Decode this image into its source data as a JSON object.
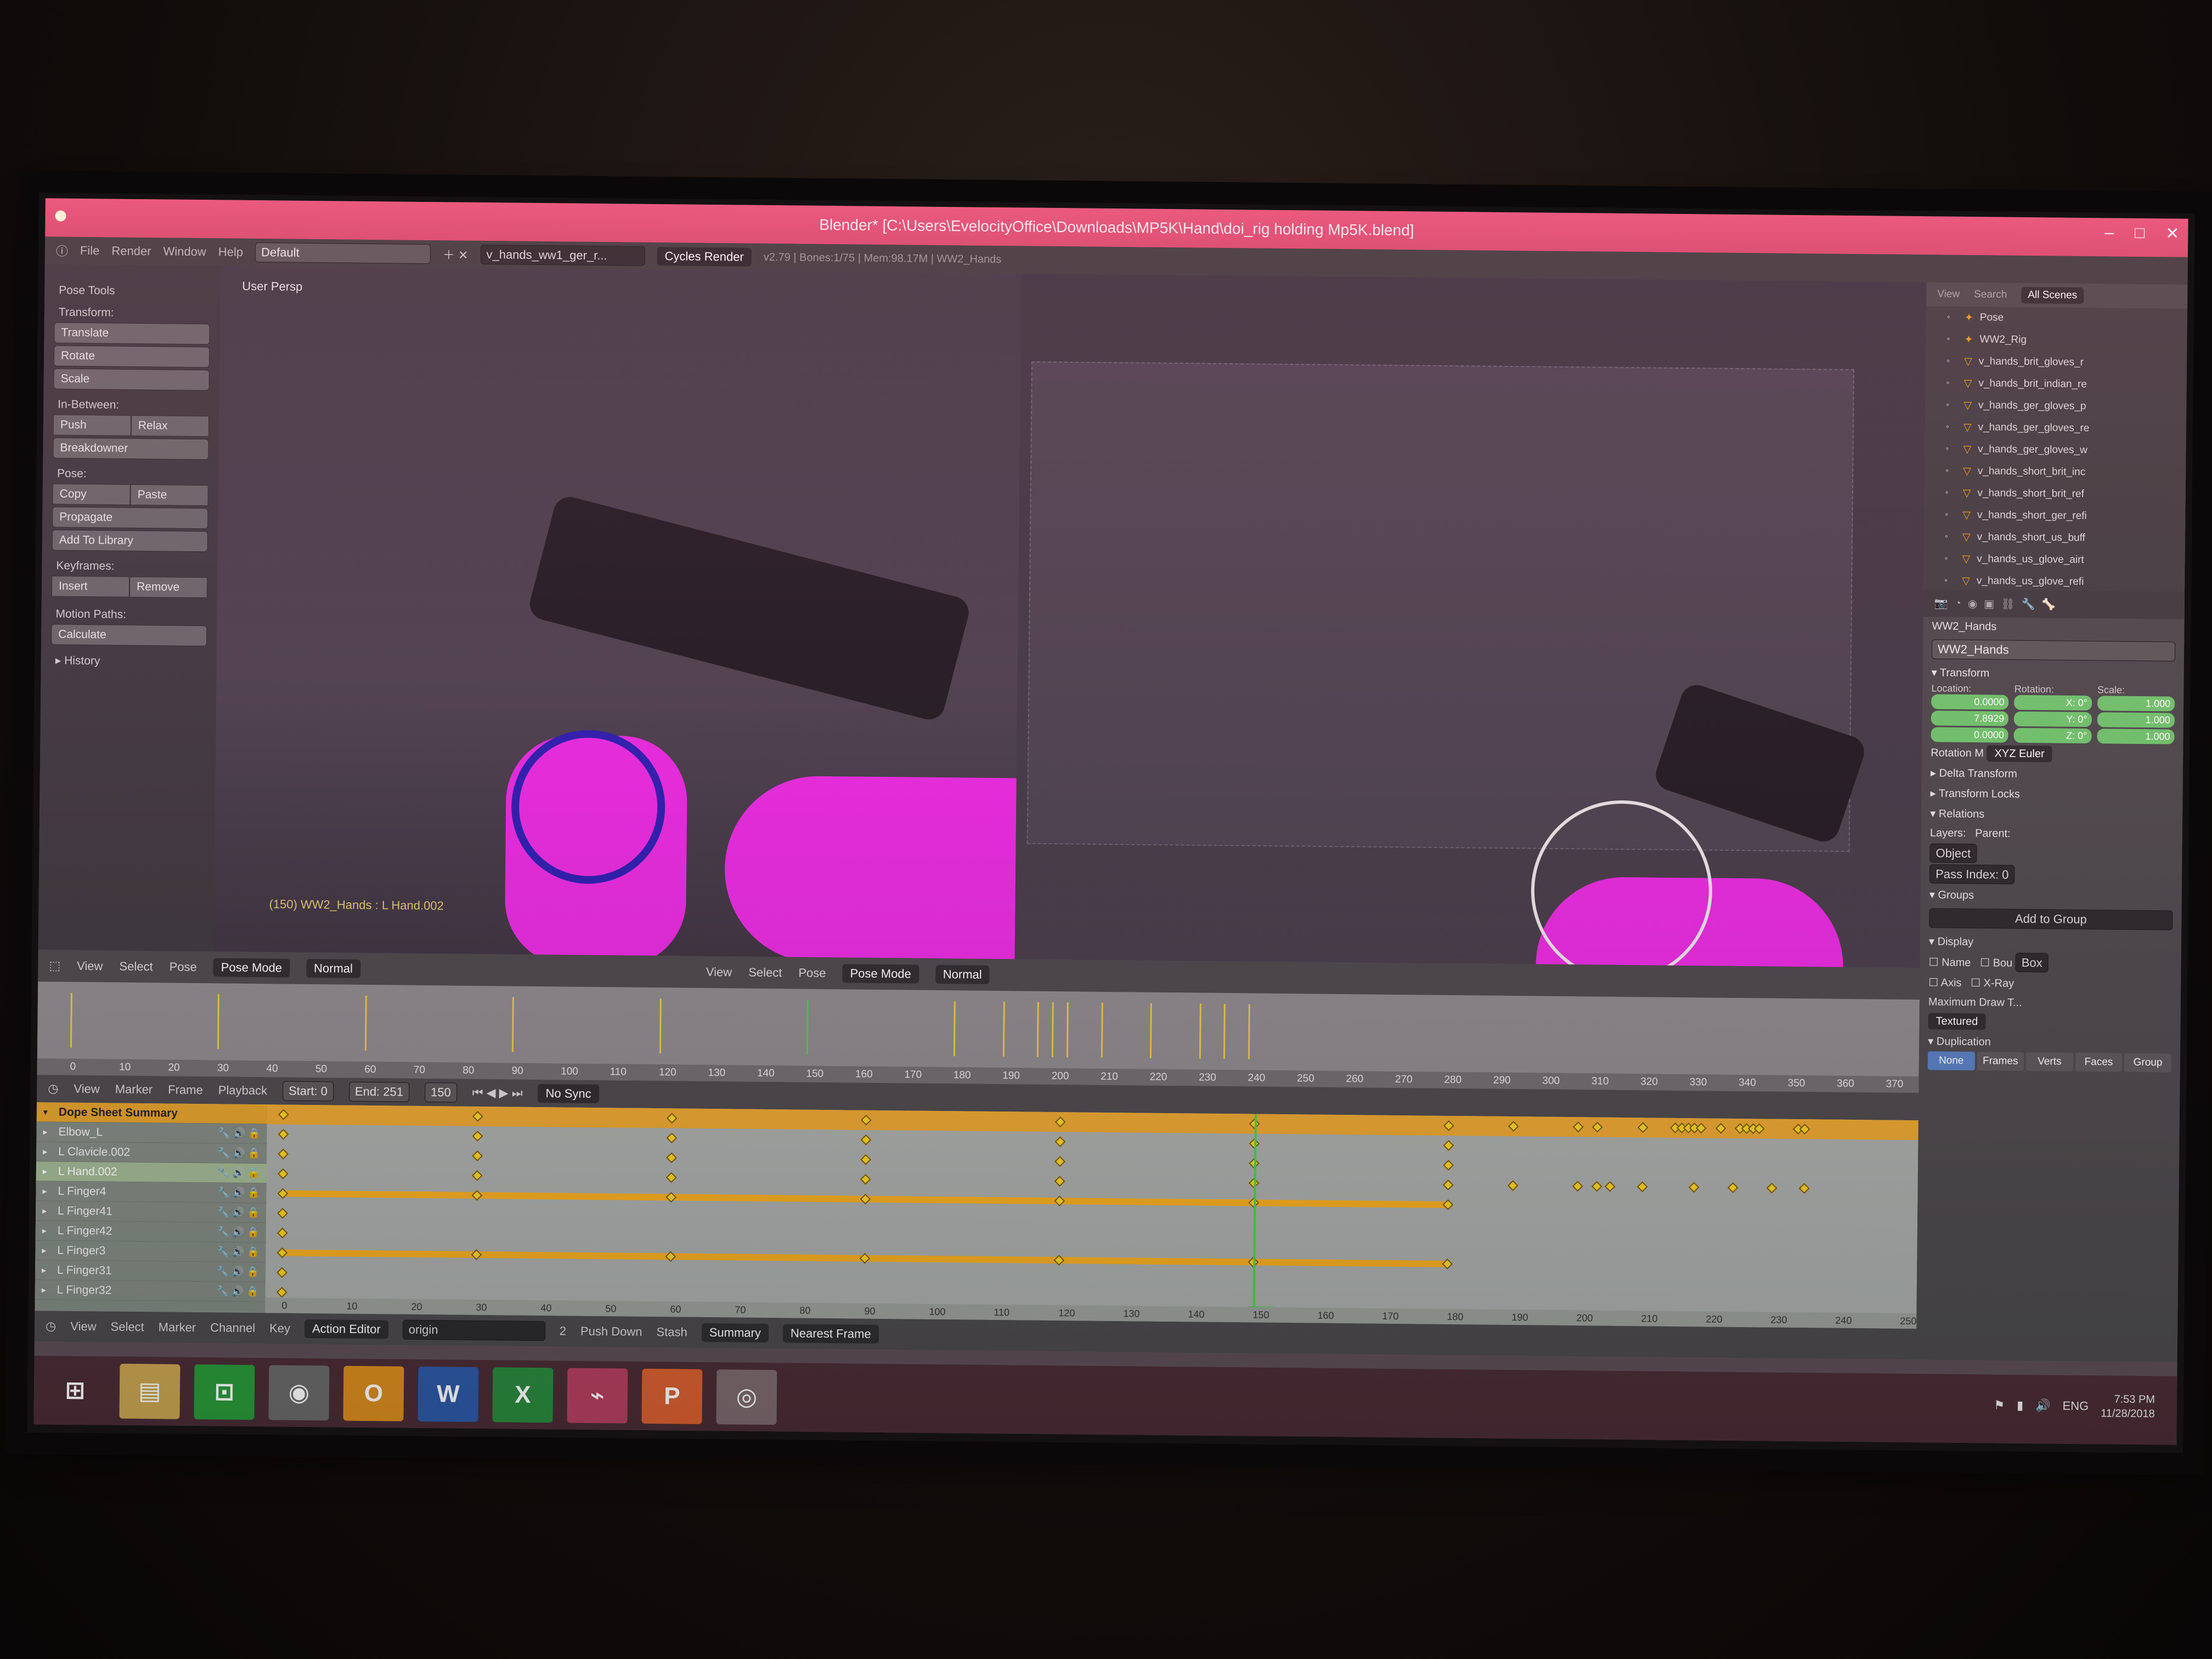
{
  "window": {
    "title": "Blender* [C:\\Users\\EvelocityOffice\\Downloads\\MP5K\\Hand\\doi_rig holding Mp5K.blend]",
    "controls": [
      "–",
      "□",
      "✕"
    ]
  },
  "menubar": {
    "items": [
      "File",
      "Render",
      "Window",
      "Help"
    ],
    "layout": "Default",
    "scene": "v_hands_ww1_ger_r...",
    "render_engine": "Cycles Render",
    "stats": "v2.79 | Bones:1/75 | Mem:98.17M | WW2_Hands"
  },
  "toolshelf": {
    "title": "Pose Tools",
    "transform_label": "Transform:",
    "translate": "Translate",
    "rotate": "Rotate",
    "scale": "Scale",
    "inbetween_label": "In-Between:",
    "push": "Push",
    "relax": "Relax",
    "breakdowner": "Breakdowner",
    "pose_label": "Pose:",
    "copy": "Copy",
    "paste": "Paste",
    "propagate": "Propagate",
    "add_to_library": "Add To Library",
    "keyframes_label": "Keyframes:",
    "insert": "Insert",
    "remove": "Remove",
    "motion_paths_label": "Motion Paths:",
    "calculate": "Calculate",
    "history": "History"
  },
  "viewport_left": {
    "label": "User Persp",
    "status": "(150) WW2_Hands : L Hand.002"
  },
  "viewport_header": {
    "view": "View",
    "select": "Select",
    "pose": "Pose",
    "mode": "Pose Mode",
    "pivot": "Normal"
  },
  "timeline": {
    "ruler": [
      "0",
      "10",
      "20",
      "30",
      "40",
      "50",
      "60",
      "70",
      "80",
      "90",
      "100",
      "110",
      "120",
      "130",
      "140",
      "150",
      "160",
      "170",
      "180",
      "190",
      "200",
      "210",
      "220",
      "230",
      "240",
      "250",
      "260",
      "270",
      "280",
      "290",
      "300",
      "310",
      "320",
      "330",
      "340",
      "350",
      "360",
      "370"
    ],
    "menus": [
      "View",
      "Marker",
      "Frame",
      "Playback"
    ],
    "start_label": "Start:",
    "start": "0",
    "end_label": "End:",
    "end": "251",
    "current": "150",
    "sync": "No Sync"
  },
  "dopesheet": {
    "channels": [
      "Dope Sheet Summary",
      "Elbow_L",
      "L Clavicle.002",
      "L Hand.002",
      "L Finger4",
      "L Finger41",
      "L Finger42",
      "L Finger3",
      "L Finger31",
      "L Finger32"
    ],
    "ruler": [
      "0",
      "10",
      "20",
      "30",
      "40",
      "50",
      "60",
      "70",
      "80",
      "90",
      "100",
      "110",
      "120",
      "130",
      "140",
      "150",
      "160",
      "170",
      "180",
      "190",
      "200",
      "210",
      "220",
      "230",
      "240",
      "250"
    ],
    "current_frame": "150"
  },
  "dope_header": {
    "menus": [
      "View",
      "Select",
      "Marker",
      "Channel",
      "Key"
    ],
    "editor": "Action Editor",
    "action": "origin",
    "users": "2",
    "push_down": "Push Down",
    "stash": "Stash",
    "summary": "Summary",
    "snap": "Nearest Frame"
  },
  "outliner": {
    "view": "View",
    "search": "Search",
    "scenes": "All Scenes",
    "items": [
      "Pose",
      "WW2_Rig",
      "v_hands_brit_gloves_r",
      "v_hands_brit_indian_re",
      "v_hands_ger_gloves_p",
      "v_hands_ger_gloves_re",
      "v_hands_ger_gloves_w",
      "v_hands_short_brit_inc",
      "v_hands_short_brit_ref",
      "v_hands_short_ger_refi",
      "v_hands_short_us_buff",
      "v_hands_us_glove_airt",
      "v_hands_us_glove_refi"
    ]
  },
  "properties": {
    "object": "WW2_Hands",
    "object_field": "WW2_Hands",
    "transform": "Transform",
    "location_label": "Location:",
    "rotation_label": "Rotation:",
    "scale_label": "Scale:",
    "location": [
      "0.0000",
      "7.8929",
      "0.0000"
    ],
    "rotation": [
      "X: 0°",
      "Y: 0°",
      "Z: 0°"
    ],
    "scale": [
      "1.000",
      "1.000",
      "1.000"
    ],
    "rotation_mode_label": "Rotation M",
    "rotation_mode": "XYZ Euler",
    "delta_transform": "Delta Transform",
    "transform_locks": "Transform Locks",
    "relations": "Relations",
    "layers_label": "Layers:",
    "parent_label": "Parent:",
    "parent_type": "Object",
    "pass_index": "Pass Index: 0",
    "groups": "Groups",
    "add_to_group": "Add to Group",
    "display": "Display",
    "name": "Name",
    "bounds": "Bou",
    "box": "Box",
    "axis": "Axis",
    "xray": "X-Ray",
    "max_draw": "Maximum Draw T...",
    "textured": "Textured",
    "duplication": "Duplication",
    "dup_options": [
      "None",
      "Frames",
      "Verts",
      "Faces",
      "Group"
    ]
  },
  "taskbar": {
    "apps": [
      "start",
      "explorer",
      "store",
      "chrome",
      "outlook",
      "word",
      "excel",
      "project",
      "powerpoint",
      "blender"
    ],
    "lang": "ENG",
    "time": "7:53 PM",
    "date": "11/28/2018"
  }
}
